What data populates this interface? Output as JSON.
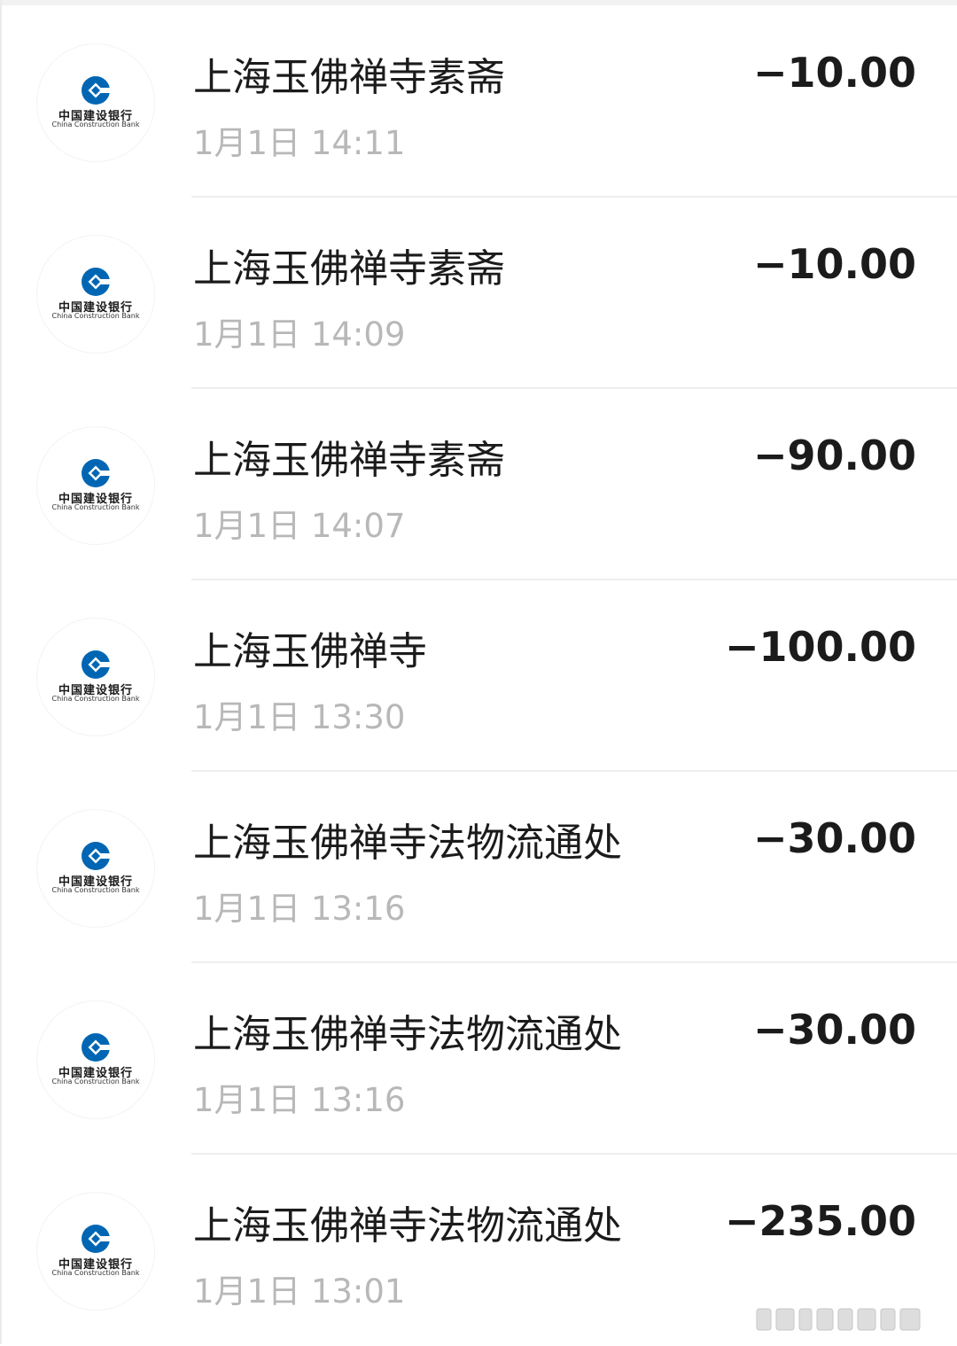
{
  "bank_logo": {
    "name_cn": "中国建设银行",
    "name_en": "China Construction Bank",
    "icon": "ccb-logo-icon",
    "brand_color": "#0066b3"
  },
  "transactions": [
    {
      "merchant": "上海玉佛禅寺素斋",
      "time": "1月1日 14:11",
      "amount": "−10.00"
    },
    {
      "merchant": "上海玉佛禅寺素斋",
      "time": "1月1日 14:09",
      "amount": "−10.00"
    },
    {
      "merchant": "上海玉佛禅寺素斋",
      "time": "1月1日 14:07",
      "amount": "−90.00"
    },
    {
      "merchant": "上海玉佛禅寺",
      "time": "1月1日 13:30",
      "amount": "−100.00"
    },
    {
      "merchant": "上海玉佛禅寺法物流通处",
      "time": "1月1日 13:16",
      "amount": "−30.00"
    },
    {
      "merchant": "上海玉佛禅寺法物流通处",
      "time": "1月1日 13:16",
      "amount": "−30.00"
    },
    {
      "merchant": "上海玉佛禅寺法物流通处",
      "time": "1月1日 13:01",
      "amount": "−235.00"
    }
  ],
  "colors": {
    "text_primary": "#1b1b1b",
    "text_secondary": "#b8b8b8",
    "divider": "#eeeeee"
  }
}
